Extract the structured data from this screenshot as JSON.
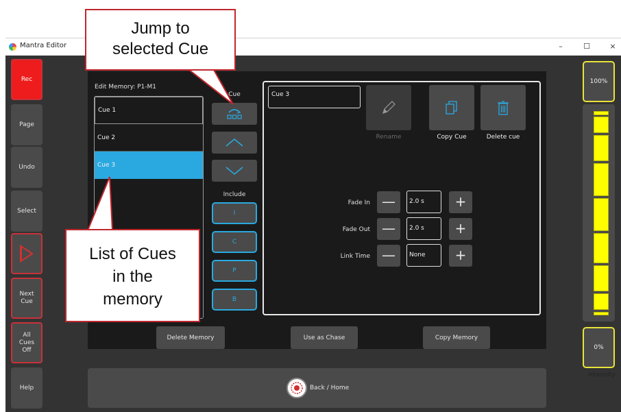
{
  "window": {
    "title": "Mantra Editor",
    "minimize": "–",
    "maximize": "☐",
    "close": "×"
  },
  "left_buttons": {
    "rec": "Rec",
    "page": "Page",
    "undo": "Undo",
    "select": "Select",
    "next_cue": "Next Cue",
    "all_cues_off": "All Cues Off",
    "help": "Help"
  },
  "edit_title": "Edit Memory: P1-M1",
  "cues": [
    "Cue 1",
    "Cue 2",
    "Cue 3"
  ],
  "selected_cue": "Cue 3",
  "middle": {
    "cue_label": "Cue",
    "include_label": "Include",
    "include_buttons": [
      "I",
      "C",
      "P",
      "B"
    ]
  },
  "detail": {
    "cue_name_value": "Cue 3",
    "rename_label": "Rename",
    "copy_cue_label": "Copy Cue",
    "delete_cue_label": "Delete cue",
    "params": [
      {
        "label": "Fade In",
        "value": "2.0 s"
      },
      {
        "label": "Fade Out",
        "value": "2.0 s"
      },
      {
        "label": "Link Time",
        "value": "None"
      }
    ]
  },
  "bottom_actions": {
    "delete_memory": "Delete Memory",
    "use_as_chase": "Use as Chase",
    "copy_memory": "Copy Memory"
  },
  "home": {
    "label": "Back / Home"
  },
  "right": {
    "top_level": "100%",
    "bottom_level": "0%",
    "intensity_label": "Intensity"
  },
  "callouts": {
    "jump": "Jump to selected Cue",
    "list": "List of Cues in the memory"
  },
  "colors": {
    "accent_blue": "#2aa9e0",
    "rec_red": "#ee1c1c",
    "callout_red": "#c0262d",
    "fader_yellow": "#ffff00"
  }
}
